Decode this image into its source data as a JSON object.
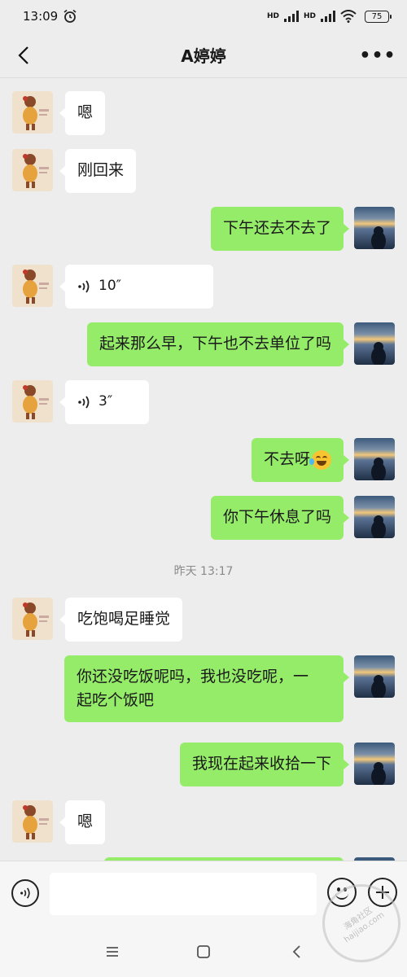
{
  "status_bar": {
    "time": "13:09",
    "battery": "75",
    "network_1": "HD",
    "network_2": "HD"
  },
  "header": {
    "title": "A婷婷",
    "more": "•••"
  },
  "messages": [
    {
      "side": "left",
      "type": "text",
      "text": "嗯"
    },
    {
      "side": "left",
      "type": "text",
      "text": "刚回来"
    },
    {
      "side": "right",
      "type": "text",
      "text": "下午还去不去了"
    },
    {
      "side": "left",
      "type": "voice",
      "duration": "10″"
    },
    {
      "side": "right",
      "type": "text",
      "text": "起来那么早，下午也不去单位了吗"
    },
    {
      "side": "left",
      "type": "voice",
      "duration": "3″"
    },
    {
      "side": "right",
      "type": "text",
      "text": "不去呀"
    },
    {
      "side": "right",
      "type": "text",
      "text": "你下午休息了吗"
    },
    {
      "type": "timestamp",
      "text": "昨天 13:17"
    },
    {
      "side": "left",
      "type": "text",
      "text": "吃饱喝足睡觉"
    },
    {
      "side": "right",
      "type": "text",
      "text_line1": "你还没吃饭呢吗，我也没吃呢，一",
      "text_line2": "起吃个饭吧"
    },
    {
      "side": "right",
      "type": "text",
      "text": "我现在起来收拾一下"
    },
    {
      "side": "left",
      "type": "text",
      "text": "嗯"
    }
  ],
  "input": {
    "value": "",
    "placeholder": ""
  },
  "watermark": {
    "line1": "海角社区",
    "line2": "haijiao.com"
  },
  "colors": {
    "background": "#ededed",
    "my_bubble": "#95ec69",
    "their_bubble": "#ffffff"
  }
}
